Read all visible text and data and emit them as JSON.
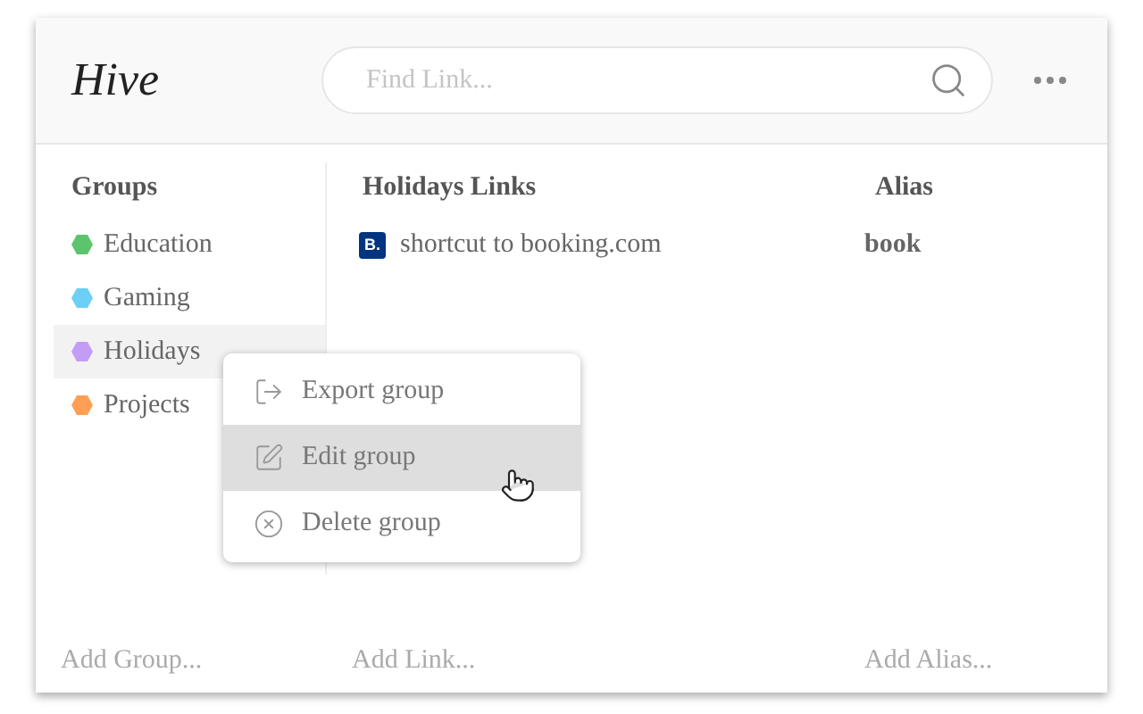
{
  "app": {
    "logo": "Hive"
  },
  "search": {
    "placeholder": "Find Link..."
  },
  "groups": {
    "heading": "Groups",
    "items": [
      {
        "label": "Education",
        "color": "#5cc46c",
        "selected": false
      },
      {
        "label": "Gaming",
        "color": "#6ccff6",
        "selected": false
      },
      {
        "label": "Holidays",
        "color": "#c39cf5",
        "selected": true
      },
      {
        "label": "Projects",
        "color": "#ff9f55",
        "selected": false
      }
    ],
    "add_placeholder": "Add Group..."
  },
  "links": {
    "heading": "Holidays Links",
    "items": [
      {
        "favicon": "B.",
        "label": "shortcut to booking.com",
        "alias": "book"
      }
    ],
    "add_placeholder": "Add Link..."
  },
  "alias": {
    "heading": "Alias",
    "add_placeholder": "Add Alias..."
  },
  "context_menu": {
    "items": [
      {
        "kind": "export",
        "label": "Export group",
        "selected": false
      },
      {
        "kind": "edit",
        "label": "Edit group",
        "selected": true
      },
      {
        "kind": "delete",
        "label": "Delete group",
        "selected": false
      }
    ]
  }
}
